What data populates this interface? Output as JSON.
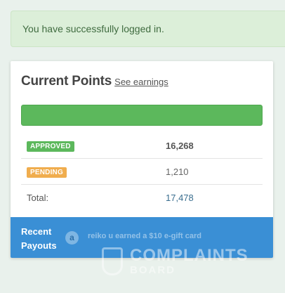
{
  "alert": {
    "message": "You have successfully logged in."
  },
  "points": {
    "title": "Current Points",
    "see_earnings": "See earnings",
    "progress_fraction": 1.0,
    "rows": [
      {
        "badge": "APPROVED",
        "value": "16,268"
      },
      {
        "badge": "PENDING",
        "value": "1,210"
      }
    ],
    "total_label": "Total:",
    "total_value": "17,478"
  },
  "payouts": {
    "label": "Recent Payouts",
    "icon_letter": "a",
    "ticker": "reiko u earned a $10 e-gift card"
  },
  "watermark": {
    "line1": "COMPLAINTS",
    "line2": "BOARD"
  },
  "colors": {
    "success_green": "#5cb85c",
    "pending_orange": "#f0ad4e",
    "payouts_blue": "#3a8fd5",
    "total_link": "#3a6e8f"
  },
  "icons": {
    "payout_avatar": "amazon-icon",
    "watermark_logo": "shield-icon"
  }
}
